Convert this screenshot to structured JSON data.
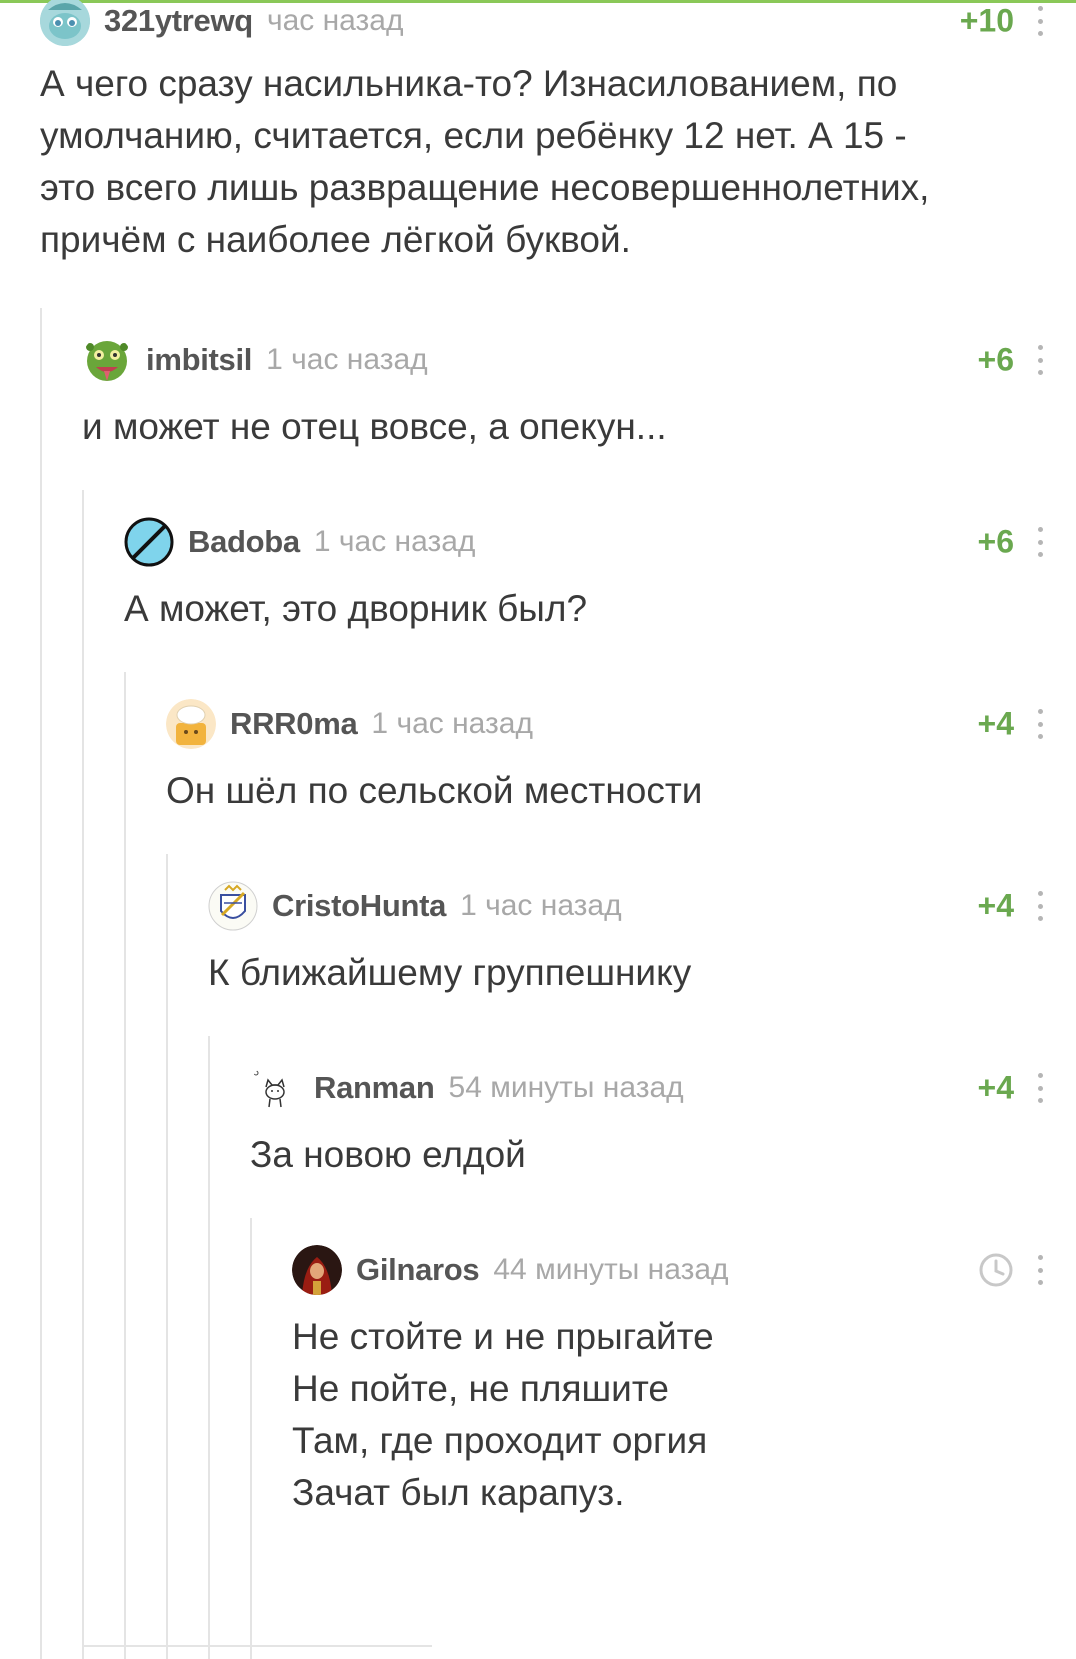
{
  "comments": [
    {
      "author": "321ytrewq",
      "time": "час назад",
      "rating": "+10",
      "avatar_icon": "pony-avatar-icon",
      "lines": [
        "А чего сразу насильника-то? Изнасилованием, по",
        "умолчанию, считается, если ребёнку 12 нет. А 15 -",
        "это всего лишь развращение несовершеннолетних,",
        "причём с наиболее лёгкой буквой."
      ]
    },
    {
      "author": "imbitsil",
      "time": "1 час назад",
      "rating": "+6",
      "avatar_icon": "green-monster-avatar-icon",
      "lines": [
        "и может не отец вовсе, а опекун..."
      ]
    },
    {
      "author": "Badoba",
      "time": "1 час назад",
      "rating": "+6",
      "avatar_icon": "crossed-circle-avatar-icon",
      "lines": [
        "А может, это дворник был?"
      ]
    },
    {
      "author": "RRR0ma",
      "time": "1 час назад",
      "rating": "+4",
      "avatar_icon": "chef-avatar-icon",
      "lines": [
        "Он шёл по сельской местности"
      ]
    },
    {
      "author": "CristoHunta",
      "time": "1 час назад",
      "rating": "+4",
      "avatar_icon": "crest-avatar-icon",
      "lines": [
        "К ближайшему группешнику"
      ]
    },
    {
      "author": "Ranman",
      "time": "54 минуты назад",
      "rating": "+4",
      "avatar_icon": "cat-sketch-avatar-icon",
      "lines": [
        "За новою елдой"
      ]
    },
    {
      "author": "Gilnaros",
      "time": "44 минуты назад",
      "rating": "",
      "rating_icon": "clock-icon",
      "avatar_icon": "red-hooded-figure-avatar-icon",
      "lines": [
        "Не стойте и не прыгайте",
        "Не пойте, не пляшите",
        "Там, где проходит оргия",
        "Зачат был карапуз."
      ]
    }
  ],
  "colors": {
    "accent": "#8ac858",
    "rating": "#6aa84f",
    "author": "#555555",
    "time": "#a8a8a8",
    "body": "#3a3a3a",
    "thread_line": "#e4e4e4"
  }
}
